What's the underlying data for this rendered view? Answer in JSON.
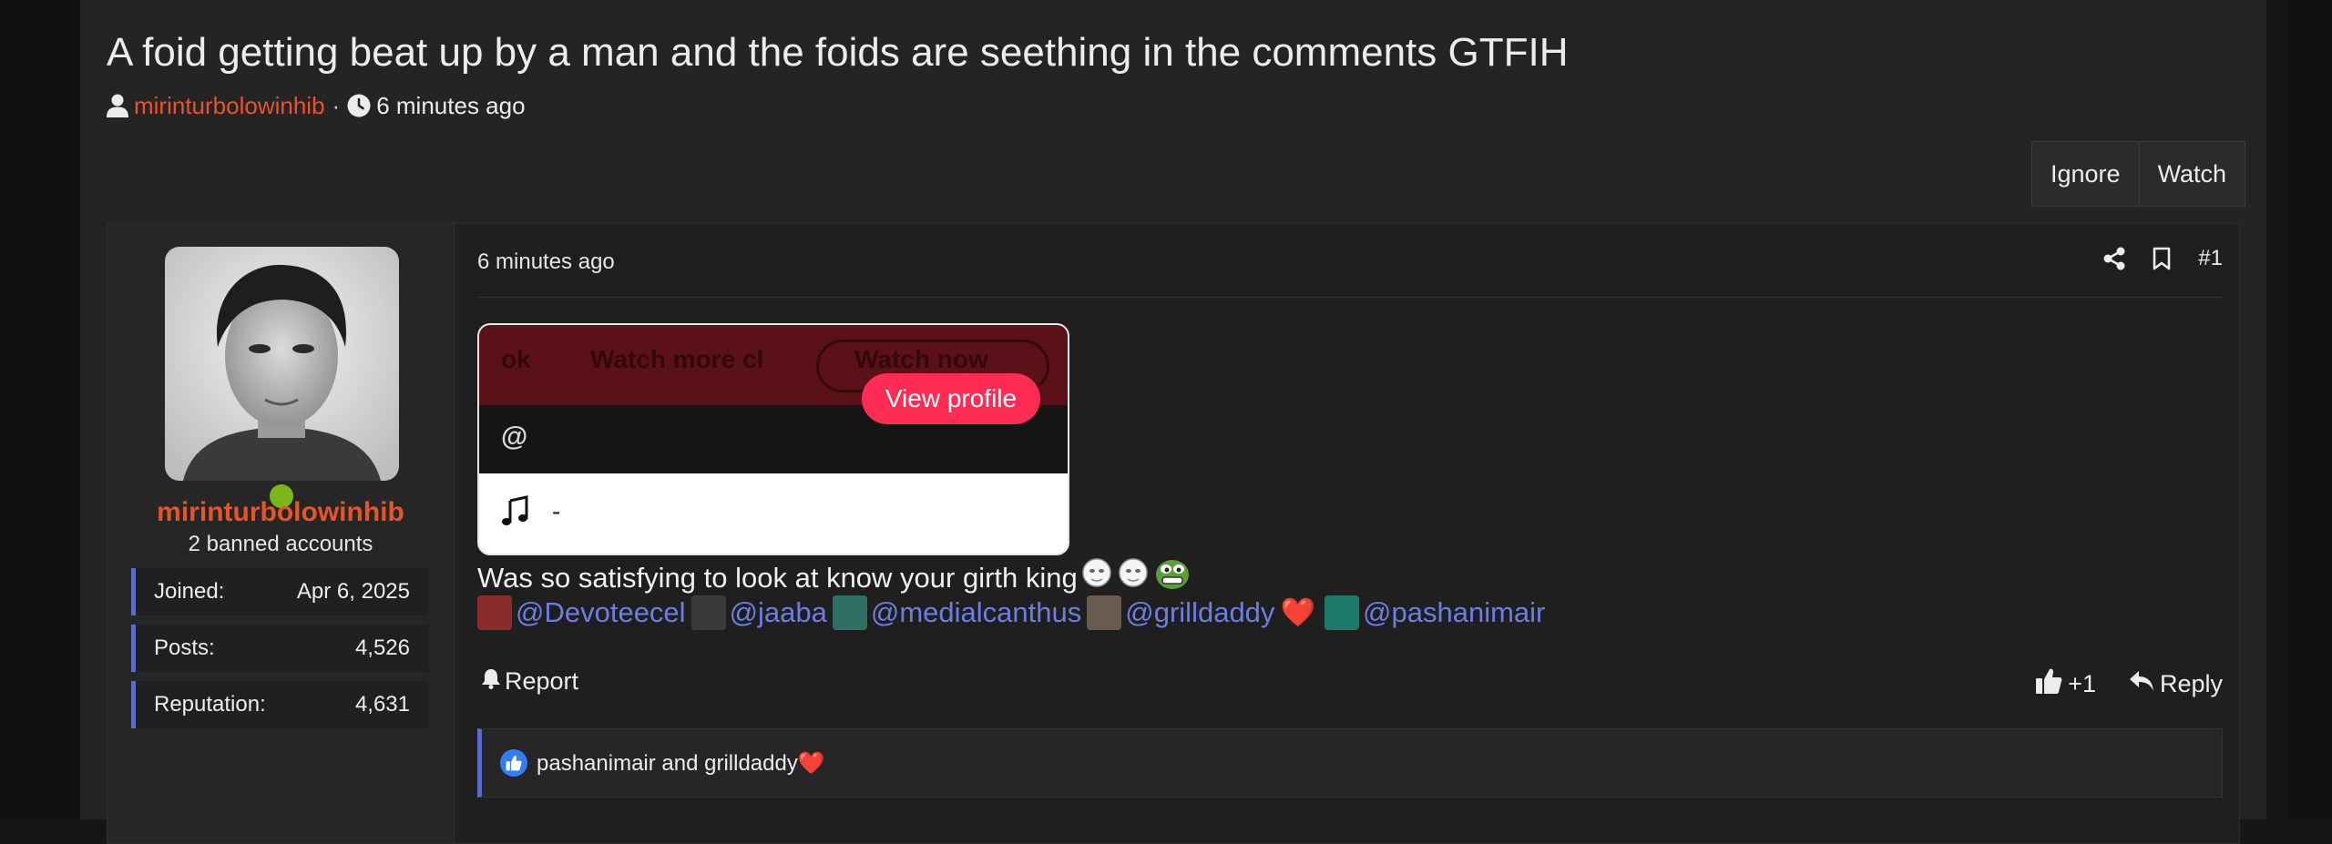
{
  "thread": {
    "title": "A foid getting beat up by a man and the foids are seething in the comments GTFIH",
    "author": "mirinturbolowinhib",
    "separator": "·",
    "time": "6 minutes ago"
  },
  "actions": {
    "ignore": "Ignore",
    "watch": "Watch"
  },
  "user": {
    "name": "mirinturbolowinhib",
    "title": "2 banned accounts",
    "stats": [
      {
        "label": "Joined:",
        "value": "Apr 6, 2025"
      },
      {
        "label": "Posts:",
        "value": "4,526"
      },
      {
        "label": "Reputation:",
        "value": "4,631"
      }
    ]
  },
  "post": {
    "time": "6 minutes ago",
    "number": "#1",
    "embed": {
      "ghost_left": "ok",
      "ghost_mid": "Watch more cl",
      "ghost_btn": "Watch now",
      "at": "@",
      "view_profile": "View profile",
      "music_text": "-"
    },
    "body": "Was so satisfying to look at know your girth king",
    "mentions": [
      {
        "handle": "@Devoteecel",
        "avatar_color": "#8a2b2b"
      },
      {
        "handle": "@jaaba",
        "avatar_color": "#3a3a3a"
      },
      {
        "handle": "@medialcanthus",
        "avatar_color": "#2f6f66"
      },
      {
        "handle": "@grilldaddy",
        "avatar_color": "#6b5a4e"
      },
      {
        "handle": "@pashanimair",
        "avatar_color": "#1b7a6a"
      }
    ],
    "heart": "❤️",
    "report": "Report",
    "like_count": "+1",
    "reply": "Reply",
    "reactions_text": "pashanimair and grilldaddy"
  },
  "colors": {
    "accent": "#e8542a",
    "link": "#6d7ee0",
    "online": "#7cb518",
    "tiktok": "#fe2c55"
  }
}
